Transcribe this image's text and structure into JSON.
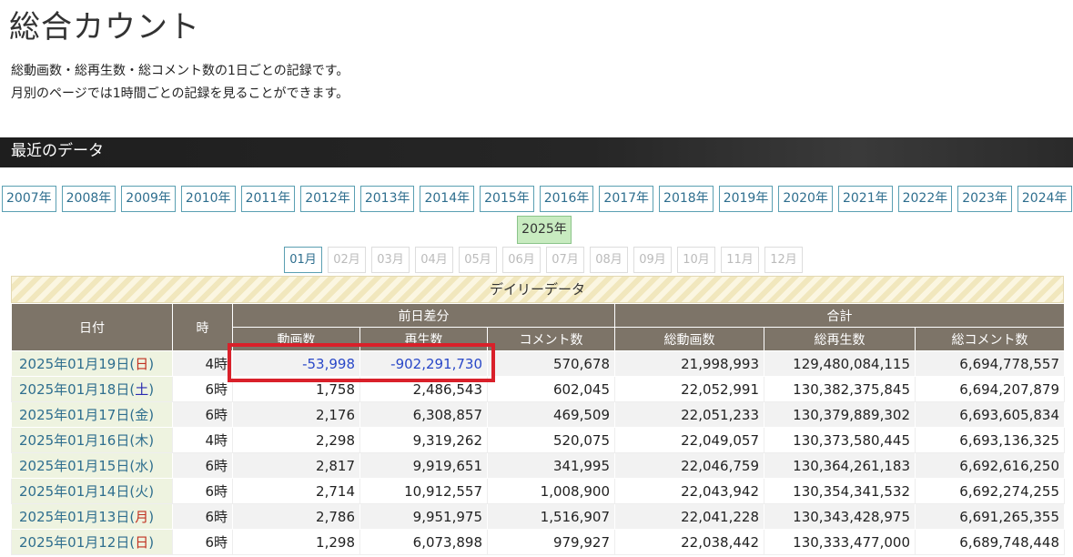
{
  "page_title": "総合カウント",
  "description": [
    "総動画数・総再生数・総コメント数の1日ごとの記録です。",
    "月別のページでは1時間ごとの記録を見ることができます。"
  ],
  "section_title": "最近のデータ",
  "years": [
    "2007年",
    "2008年",
    "2009年",
    "2010年",
    "2011年",
    "2012年",
    "2013年",
    "2014年",
    "2015年",
    "2016年",
    "2017年",
    "2018年",
    "2019年",
    "2020年",
    "2021年",
    "2022年",
    "2023年",
    "2024年"
  ],
  "current_year": "2025年",
  "months": [
    {
      "label": "01月",
      "active": true
    },
    {
      "label": "02月",
      "active": false
    },
    {
      "label": "03月",
      "active": false
    },
    {
      "label": "04月",
      "active": false
    },
    {
      "label": "05月",
      "active": false
    },
    {
      "label": "06月",
      "active": false
    },
    {
      "label": "07月",
      "active": false
    },
    {
      "label": "08月",
      "active": false
    },
    {
      "label": "09月",
      "active": false
    },
    {
      "label": "10月",
      "active": false
    },
    {
      "label": "11月",
      "active": false
    },
    {
      "label": "12月",
      "active": false
    }
  ],
  "table": {
    "caption": "デイリーデータ",
    "headers": {
      "date": "日付",
      "hour": "時",
      "diff_group": "前日差分",
      "total_group": "合計",
      "diff_videos": "動画数",
      "diff_views": "再生数",
      "diff_comments": "コメント数",
      "total_videos": "総動画数",
      "total_views": "総再生数",
      "total_comments": "総コメント数"
    },
    "rows": [
      {
        "date": "2025年01月19日(",
        "weekday": "日",
        "weekday_type": "sun",
        "hour": "4時",
        "diff_videos": "-53,998",
        "diff_views": "-902,291,730",
        "diff_comments": "570,678",
        "total_videos": "21,998,993",
        "total_views": "129,480,084,115",
        "total_comments": "6,694,778,557",
        "negative": true
      },
      {
        "date": "2025年01月18日(",
        "weekday": "土",
        "weekday_type": "sat",
        "hour": "6時",
        "diff_videos": "1,758",
        "diff_views": "2,486,543",
        "diff_comments": "602,045",
        "total_videos": "22,052,991",
        "total_views": "130,382,375,845",
        "total_comments": "6,694,207,879",
        "negative": false
      },
      {
        "date": "2025年01月17日(",
        "weekday": "金",
        "weekday_type": "wk",
        "hour": "6時",
        "diff_videos": "2,176",
        "diff_views": "6,308,857",
        "diff_comments": "469,509",
        "total_videos": "22,051,233",
        "total_views": "130,379,889,302",
        "total_comments": "6,693,605,834",
        "negative": false
      },
      {
        "date": "2025年01月16日(",
        "weekday": "木",
        "weekday_type": "wk",
        "hour": "4時",
        "diff_videos": "2,298",
        "diff_views": "9,319,262",
        "diff_comments": "520,075",
        "total_videos": "22,049,057",
        "total_views": "130,373,580,445",
        "total_comments": "6,693,136,325",
        "negative": false
      },
      {
        "date": "2025年01月15日(",
        "weekday": "水",
        "weekday_type": "wk",
        "hour": "6時",
        "diff_videos": "2,817",
        "diff_views": "9,919,651",
        "diff_comments": "341,995",
        "total_videos": "22,046,759",
        "total_views": "130,364,261,183",
        "total_comments": "6,692,616,250",
        "negative": false
      },
      {
        "date": "2025年01月14日(",
        "weekday": "火",
        "weekday_type": "wk",
        "hour": "6時",
        "diff_videos": "2,714",
        "diff_views": "10,912,557",
        "diff_comments": "1,008,900",
        "total_videos": "22,043,942",
        "total_views": "130,354,341,532",
        "total_comments": "6,692,274,255",
        "negative": false
      },
      {
        "date": "2025年01月13日(",
        "weekday": "月",
        "weekday_type": "sun",
        "hour": "6時",
        "diff_videos": "2,786",
        "diff_views": "9,951,975",
        "diff_comments": "1,516,907",
        "total_videos": "22,041,228",
        "total_views": "130,343,428,975",
        "total_comments": "6,691,265,355",
        "negative": false
      },
      {
        "date": "2025年01月12日(",
        "weekday": "日",
        "weekday_type": "sun",
        "hour": "6時",
        "diff_videos": "1,298",
        "diff_views": "6,073,898",
        "diff_comments": "979,927",
        "total_videos": "22,038,442",
        "total_views": "130,333,477,000",
        "total_comments": "6,689,748,448",
        "negative": false
      }
    ]
  },
  "colors": {
    "header_bg": "#7d7468",
    "negative_value": "#2a48c8",
    "highlight_border": "#d9202a",
    "current_year_bg": "#c8ebc0"
  }
}
